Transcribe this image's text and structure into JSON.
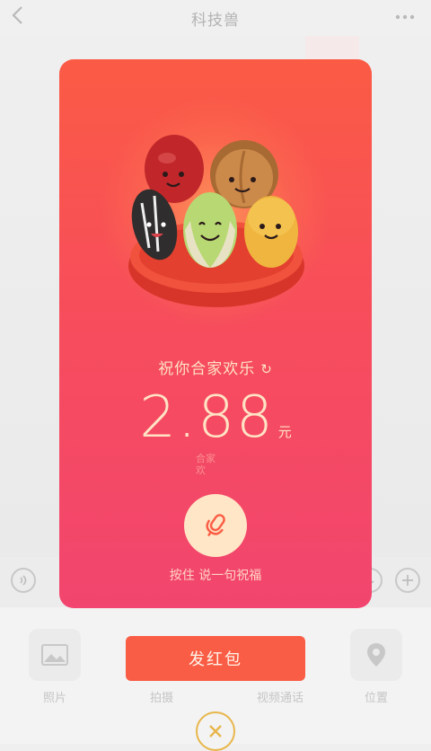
{
  "header": {
    "title": "科技兽",
    "back_icon": "chevron-left-icon",
    "more_icon": "more-horizontal-icon"
  },
  "input_row": {
    "voice_icon": "voice-icon",
    "emoji_icon": "emoji-icon",
    "plus_icon": "plus-icon"
  },
  "toolbar": {
    "items": [
      {
        "label": "照片",
        "icon": "image-icon"
      },
      {
        "label": "拍摄",
        "icon": "camera-icon"
      },
      {
        "label": "视频通话",
        "icon": "video-call-icon"
      },
      {
        "label": "位置",
        "icon": "location-icon"
      }
    ]
  },
  "red_packet": {
    "greeting": "祝你合家欢乐",
    "refresh_icon": "refresh-icon",
    "amount": "2.88",
    "unit": "元",
    "ghost_text": "合家欢",
    "mic_icon": "microphone-icon",
    "hint": "按住 说一句祝福",
    "send_label": "发红包",
    "close_icon": "close-icon"
  },
  "colors": {
    "card_top": "#fb5b45",
    "card_bottom": "#f2456f",
    "text_cream": "#ffe3c4",
    "send_button": "#fa5d45",
    "close_gold": "#e8b64b"
  }
}
